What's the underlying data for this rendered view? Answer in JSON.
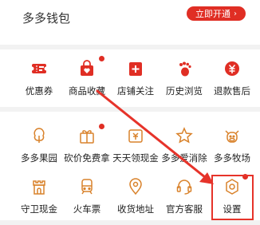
{
  "wallet": {
    "title": "多多钱包",
    "button_label": "立即开通"
  },
  "orders_row": [
    {
      "label": "优惠券",
      "icon": "coupon-icon"
    },
    {
      "label": "商品收藏",
      "icon": "favorites-bag-icon"
    },
    {
      "label": "店铺关注",
      "icon": "store-follow-icon"
    },
    {
      "label": "历史浏览",
      "icon": "footprint-icon"
    },
    {
      "label": "退款售后",
      "icon": "refund-icon"
    }
  ],
  "services_row1": [
    {
      "label": "多多果园",
      "icon": "tree-icon"
    },
    {
      "label": "砍价免费拿",
      "icon": "gift-icon"
    },
    {
      "label": "天天领现金",
      "icon": "cash-icon"
    },
    {
      "label": "多多爱消除",
      "icon": "star-icon"
    },
    {
      "label": "多多牧场",
      "icon": "cow-icon"
    }
  ],
  "services_row2": [
    {
      "label": "守卫现金",
      "icon": "tower-icon"
    },
    {
      "label": "火车票",
      "icon": "train-icon"
    },
    {
      "label": "收货地址",
      "icon": "location-icon"
    },
    {
      "label": "官方客服",
      "icon": "headset-icon"
    },
    {
      "label": "设置",
      "icon": "settings-icon"
    }
  ],
  "colors": {
    "accent": "#e02e24",
    "icon_orange": "#d9822b",
    "highlight": "#e6332a"
  }
}
